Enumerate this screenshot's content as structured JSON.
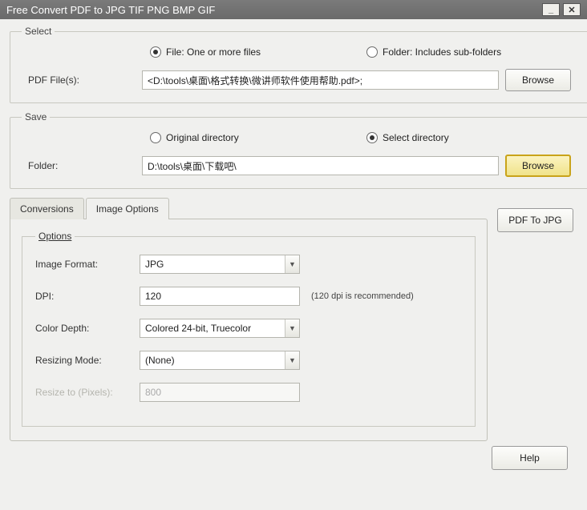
{
  "window": {
    "title": "Free Convert PDF to JPG TIF PNG BMP GIF"
  },
  "select": {
    "legend": "Select",
    "radio_file": "File:  One or more files",
    "radio_folder": "Folder: Includes sub-folders",
    "mode": "file",
    "file_label": "PDF File(s):",
    "file_value": "<D:\\tools\\桌面\\格式转换\\微讲师软件使用帮助.pdf>;",
    "browse": "Browse"
  },
  "save": {
    "legend": "Save",
    "radio_original": "Original directory",
    "radio_select": "Select directory",
    "mode": "select",
    "folder_label": "Folder:",
    "folder_value": "D:\\tools\\桌面\\下载吧\\",
    "browse": "Browse"
  },
  "tabs": {
    "conversions": "Conversions",
    "image_options": "Image Options",
    "active": "image_options"
  },
  "options": {
    "legend": "Options",
    "format_label": "Image Format:",
    "format_value": "JPG",
    "dpi_label": "DPI:",
    "dpi_value": "120",
    "dpi_hint": "(120 dpi is recommended)",
    "depth_label": "Color Depth:",
    "depth_value": "Colored 24-bit, Truecolor",
    "resize_mode_label": "Resizing Mode:",
    "resize_mode_value": "(None)",
    "resize_px_label": "Resize to (Pixels):",
    "resize_px_value": "800"
  },
  "actions": {
    "convert": "PDF To JPG",
    "help": "Help"
  }
}
